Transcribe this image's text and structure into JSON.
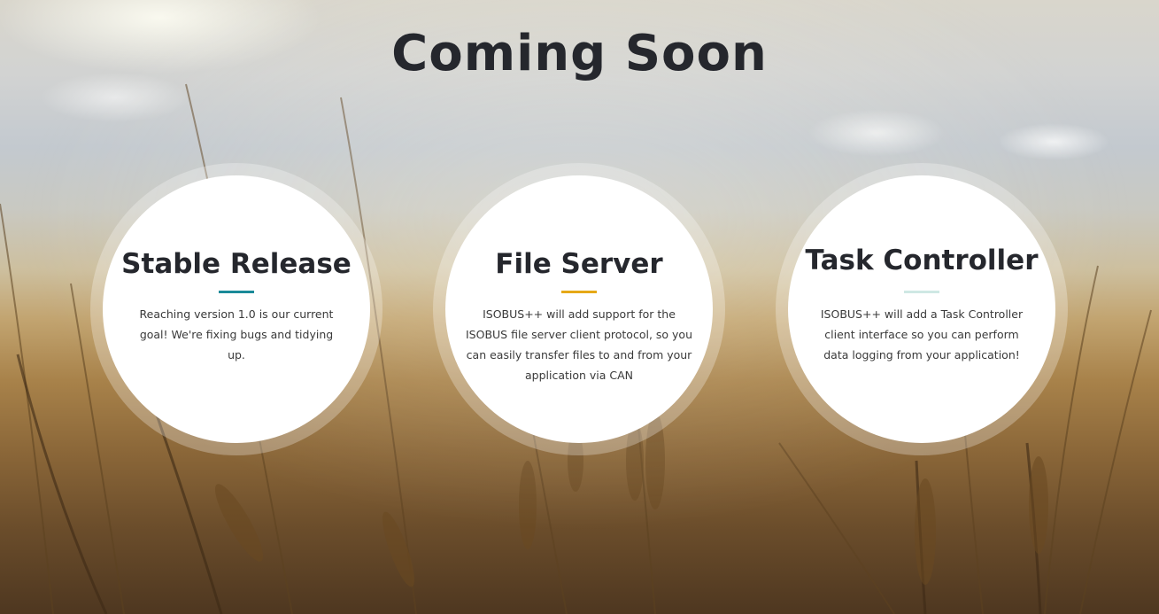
{
  "page": {
    "title": "Coming Soon"
  },
  "features": [
    {
      "title": "Stable Release",
      "description": "Reaching version 1.0 is our current goal! We're fixing bugs and tidying up.",
      "accent": "#1a8a99"
    },
    {
      "title": "File Server",
      "description": "ISOBUS++ will add support for the ISOBUS file server client protocol, so you can easily transfer files to and from your application via CAN",
      "accent": "#e6a817"
    },
    {
      "title": "Task Controller",
      "description": "ISOBUS++ will add a Task Controller client interface so you can perform data logging from your application!",
      "accent": "#cfe8e4"
    }
  ],
  "colors": {
    "heading": "#25272d",
    "circle_bg": "#ffffff"
  }
}
